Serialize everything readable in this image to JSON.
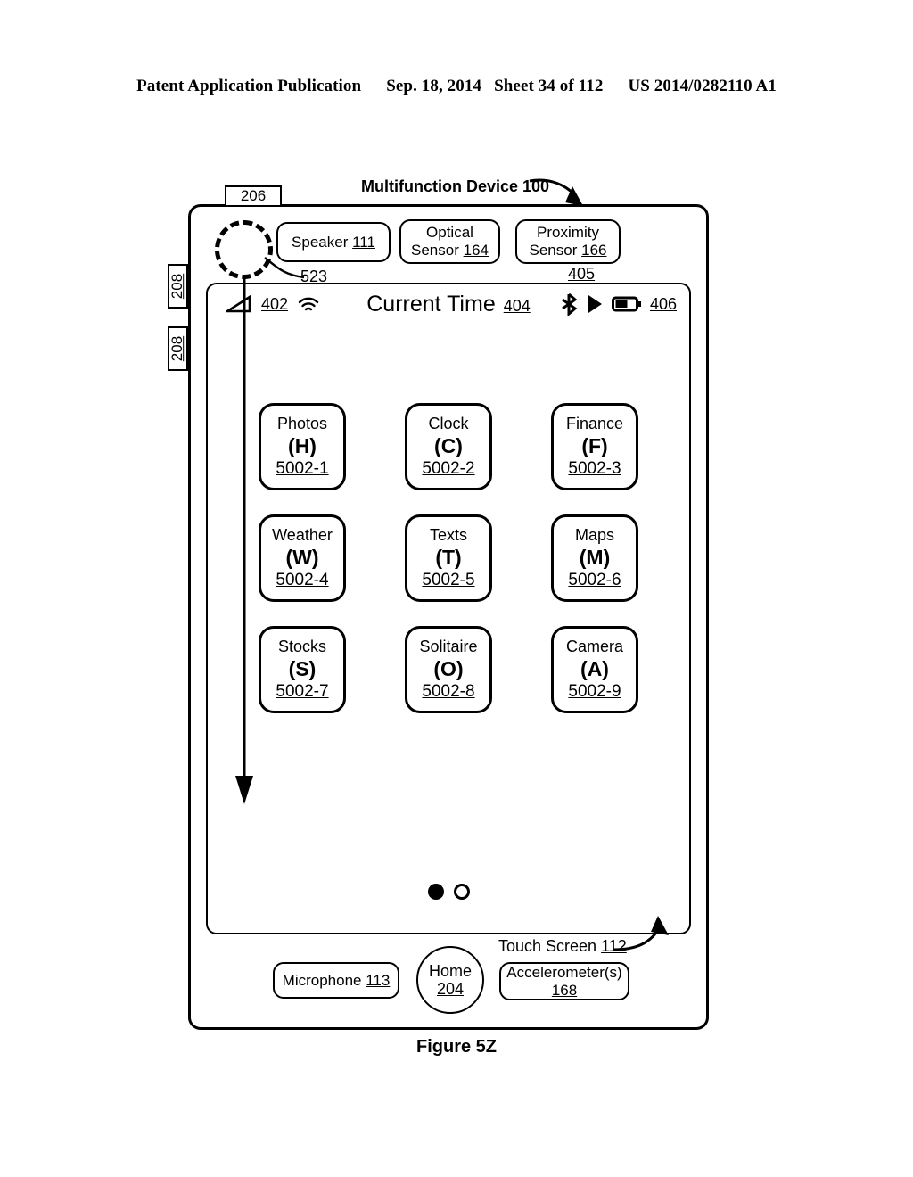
{
  "header": {
    "publication": "Patent Application Publication",
    "date": "Sep. 18, 2014",
    "sheet": "Sheet 34 of 112",
    "patent_number": "US 2014/0282110 A1"
  },
  "figure": {
    "caption": "Figure 5Z"
  },
  "device": {
    "title": "Multifunction Device 100",
    "power_button_ref": "206",
    "side_button_upper_ref": "208",
    "side_button_lower_ref": "208",
    "speaker": {
      "label": "Speaker",
      "ref": "111"
    },
    "optical_sensor": {
      "line1": "Optical",
      "line2": "Sensor",
      "ref": "164"
    },
    "proximity_sensor": {
      "line1": "Proximity",
      "line2": "Sensor",
      "ref": "166"
    },
    "microphone": {
      "label": "Microphone",
      "ref": "113"
    },
    "accelerometer": {
      "label": "Accelerometer(s)",
      "ref": "168"
    },
    "home_button": {
      "label": "Home",
      "ref": "204"
    },
    "touch_screen": {
      "label": "Touch Screen",
      "ref": "112"
    },
    "gesture": {
      "ref": "523"
    },
    "status_bar_ref": "405"
  },
  "status_bar": {
    "signal_icon": "signal-strength-icon",
    "signal_ref": "402",
    "wifi_icon": "wifi-icon",
    "time_label": "Current Time",
    "time_ref": "404",
    "bluetooth_icon": "bluetooth-icon",
    "play_icon": "play-icon",
    "battery_icon": "battery-icon",
    "battery_ref": "406"
  },
  "app_grid": {
    "rows": [
      [
        {
          "name": "Photos",
          "letter": "(H)",
          "ref": "5002-1"
        },
        {
          "name": "Clock",
          "letter": "(C)",
          "ref": "5002-2"
        },
        {
          "name": "Finance",
          "letter": "(F)",
          "ref": "5002-3"
        }
      ],
      [
        {
          "name": "Weather",
          "letter": "(W)",
          "ref": "5002-4"
        },
        {
          "name": "Texts",
          "letter": "(T)",
          "ref": "5002-5"
        },
        {
          "name": "Maps",
          "letter": "(M)",
          "ref": "5002-6"
        }
      ],
      [
        {
          "name": "Stocks",
          "letter": "(S)",
          "ref": "5002-7"
        },
        {
          "name": "Solitaire",
          "letter": "(O)",
          "ref": "5002-8"
        },
        {
          "name": "Camera",
          "letter": "(A)",
          "ref": "5002-9"
        }
      ]
    ]
  },
  "page_indicator": {
    "total_pages": 2,
    "current_page": 1
  },
  "colors": {
    "ink": "#000000",
    "paper": "#ffffff"
  }
}
